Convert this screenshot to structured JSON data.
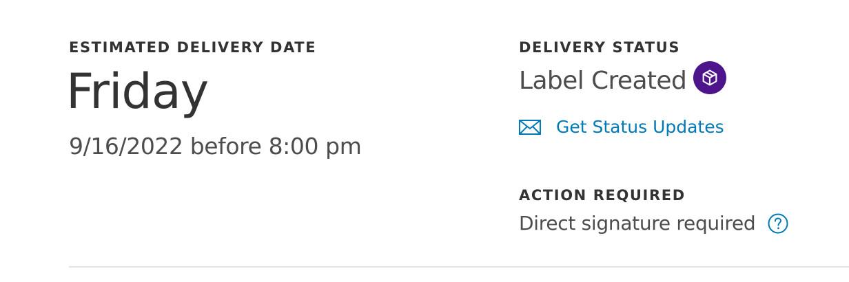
{
  "estimated": {
    "heading": "ESTIMATED DELIVERY DATE",
    "day": "Friday",
    "date_line": "9/16/2022 before 8:00 pm"
  },
  "delivery_status": {
    "heading": "DELIVERY STATUS",
    "status": "Label Created",
    "status_icon": "package-icon",
    "badge_color": "#4d148c",
    "updates_icon": "envelope-icon",
    "updates_link": "Get Status Updates",
    "link_color": "#007ab7"
  },
  "action_required": {
    "heading": "ACTION REQUIRED",
    "text": "Direct signature required",
    "help_icon": "help-circle-icon"
  }
}
